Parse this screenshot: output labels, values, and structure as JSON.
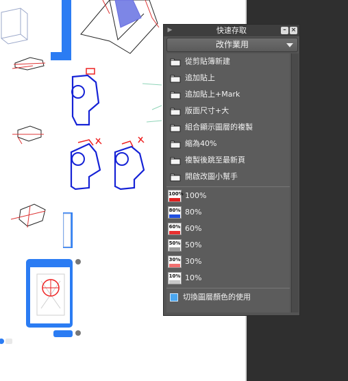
{
  "panel": {
    "title": "快速存取",
    "set_selected": "改作業用",
    "actions": [
      {
        "label": "從剪貼簿新建",
        "icon": "folder-icon"
      },
      {
        "label": "追加貼上",
        "icon": "folder-icon"
      },
      {
        "label": "追加貼上+Mark",
        "icon": "folder-icon"
      },
      {
        "label": "版面尺寸+大",
        "icon": "folder-icon"
      },
      {
        "label": "組合顯示圖層的複製",
        "icon": "folder-icon"
      },
      {
        "label": "縮為40%",
        "icon": "folder-icon"
      },
      {
        "label": "複製後跳至最新頁",
        "icon": "folder-icon"
      },
      {
        "label": "開啟改圖小幫手",
        "icon": "folder-icon"
      }
    ],
    "opacities": [
      {
        "badge": "100%",
        "label": "100%",
        "color": "#e02020"
      },
      {
        "badge": "80%",
        "label": "80%",
        "color": "#2050e0"
      },
      {
        "badge": "60%",
        "label": "60%",
        "color": "#e83030"
      },
      {
        "badge": "50%",
        "label": "50%",
        "color": "#9a9a9a"
      },
      {
        "badge": "30%",
        "label": "30%",
        "color": "#f07070"
      },
      {
        "badge": "10%",
        "label": "10%",
        "color": "#c8c8c8"
      }
    ],
    "toggle_label": "切換圖層顏色的使用",
    "toggle_icon": "checkbox-icon"
  }
}
